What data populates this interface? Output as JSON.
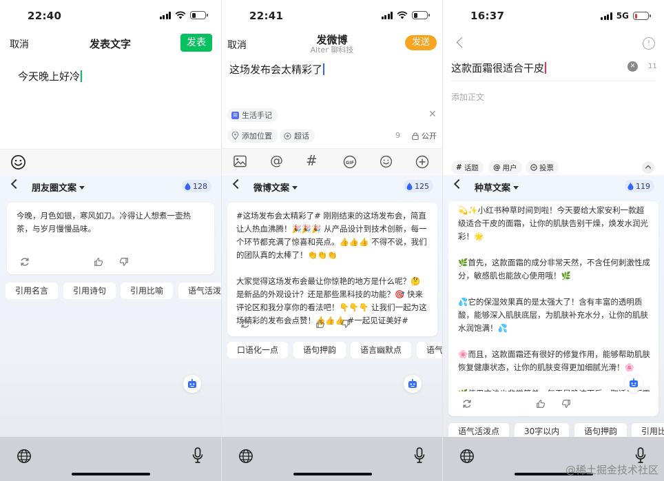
{
  "colors": {
    "wechat_green": "#07c160",
    "weibo_orange": "#f7a521",
    "accent_blue": "#3366ff",
    "xhs_red": "#e8334a",
    "credit_bg": "#e3ebfb"
  },
  "watermark": "@稀土掘金技术社区",
  "phones": [
    {
      "status_time": "22:40",
      "cancel": "取消",
      "title": "发表文字",
      "publish": "发表",
      "input_text": "今天晚上好冷",
      "keyboard": {
        "title": "朋友圈文案",
        "credits": "128",
        "card_text": "今晚，月色如银，寒风如刀。冷得让人想煮一壶热茶，与岁月慢慢品味。",
        "chips": [
          "引用名言",
          "引用诗句",
          "引用比喻",
          "语气活泼"
        ]
      }
    },
    {
      "status_time": "22:41",
      "cancel": "取消",
      "title": "发微博",
      "subtitle": "Alter 聊科技",
      "publish": "发送",
      "input_text": "这场发布会太精彩了",
      "tag": "生活手记",
      "location": "添加位置",
      "super_topic": "超话",
      "char_count": "9",
      "visibility": "公开",
      "keyboard": {
        "title": "微博文案",
        "credits": "125",
        "card_text": "#这场发布会太精彩了# 刚刚结束的这场发布会，简直让人热血沸腾！🎉🎉🎉 从产品设计到技术创新，每一个环节都充满了惊喜和亮点。👍👍👍 不得不说，我们的团队真的太棒了！👏👏👏\n\n大家觉得这场发布会最让你惊艳的地方是什么呢？🤔 是新品的外观设计？还是那些黑科技的功能？🎯 快来评论区和我分享你的看法吧！👇👇👇 让我们一起为这场精彩的发布会点赞！👍👍👍 #一起见证美好#",
        "chips": [
          "口语化一点",
          "语句押韵",
          "语言幽默点",
          "语气"
        ]
      }
    },
    {
      "status_time": "16:37",
      "network": "5G",
      "title_input": "这款面霜很适合干皮",
      "title_count": "11",
      "body_placeholder": "添加正文",
      "tags": [
        "话题",
        "用户",
        "投票"
      ],
      "keyboard": {
        "title": "种草文案",
        "credits": "119",
        "card_text": "💫✨小红书种草时间到啦！今天要给大家安利一款超级适合干皮的面霜，让你的肌肤告别干燥，焕发水润光彩！🌟\n\n🌿首先，这款面霜的成分非常天然，不含任何刺激性成分，敏感肌也能放心使用哦！🌿\n\n💦它的保湿效果真的是太强大了！含有丰富的透明质酸，能够深入肌肤底层，为肌肤补充水分，让你的肌肤水润饱满！💦\n\n🌸而且，这款面霜还有很好的修复作用，能够帮助肌肤恢复健康状态，让你的肌肤变得更加细腻光滑！🌸\n\n🌿使用方法也非常简单，每天早晚洁面后，取适量面霜均匀涂抹于面部，轻轻按摩至吸收即可！🌿\n\n💗总之，这款面霜真的是干皮MM的福音！快来试试",
        "chips": [
          "语气活泼点",
          "30字以内",
          "语句押韵",
          "引用比"
        ]
      }
    }
  ]
}
